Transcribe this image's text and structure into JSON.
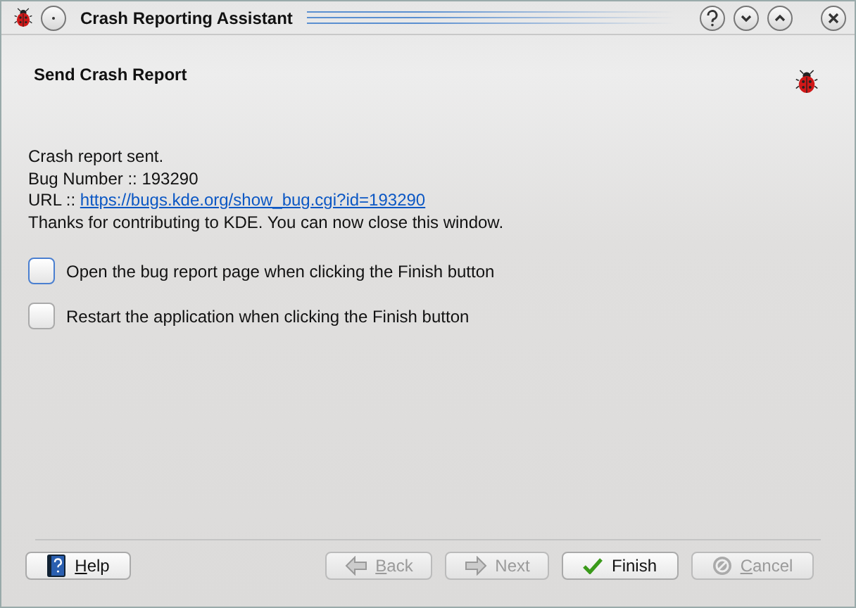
{
  "window": {
    "title": "Crash Reporting Assistant"
  },
  "page": {
    "title": "Send Crash Report"
  },
  "message": [
    {
      "kind": "text",
      "text": "Crash report sent."
    },
    {
      "kind": "text",
      "text": "Bug Number :: 193290"
    },
    {
      "kind": "link",
      "prefix": "URL :: ",
      "text": "https://bugs.kde.org/show_bug.cgi?id=193290"
    },
    {
      "kind": "text",
      "text": "Thanks for contributing to KDE. You can now close this window."
    }
  ],
  "options": [
    {
      "label": "Open the bug report page when clicking the Finish button",
      "checked": false,
      "focused": true
    },
    {
      "label": "Restart the application when clicking the Finish button",
      "checked": false,
      "focused": false
    }
  ],
  "buttons": [
    {
      "kind": "help",
      "label": "Help",
      "first_letter_underlined": true,
      "disabled": false
    },
    {
      "kind": "back",
      "label": "Back",
      "first_letter_underlined": true,
      "disabled": true
    },
    {
      "kind": "next",
      "label": "Next",
      "first_letter_underlined": false,
      "disabled": true
    },
    {
      "kind": "finish",
      "label": "Finish",
      "first_letter_underlined": false,
      "disabled": false
    },
    {
      "kind": "cancel",
      "label": "Cancel",
      "first_letter_underlined": true,
      "disabled": true
    }
  ]
}
